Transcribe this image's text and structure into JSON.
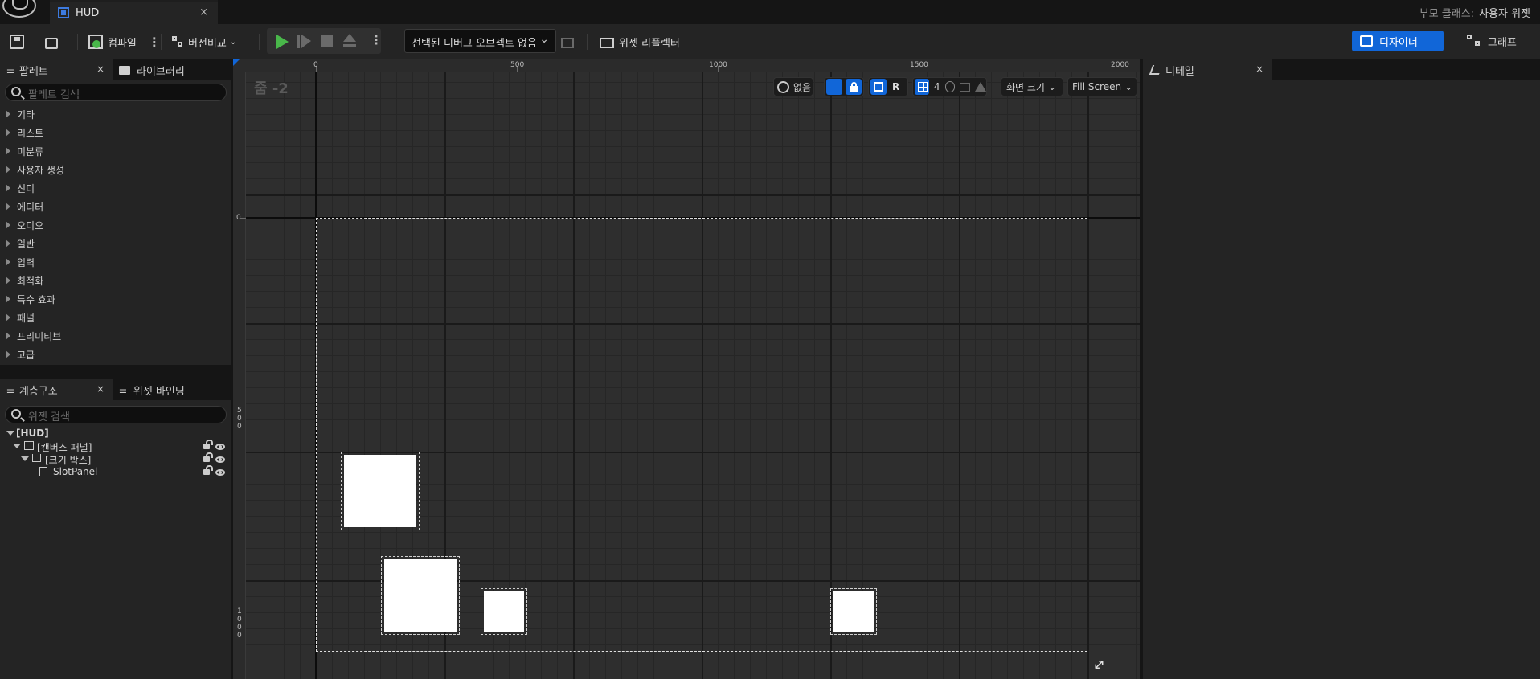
{
  "title_bar": {
    "tab_label": "HUD",
    "tab_close": "×",
    "parent_class_label": "부모 클래스:",
    "parent_class_value": "사용자 위젯"
  },
  "toolbar": {
    "compile_label": "컴파일",
    "diff_label": "버전비교",
    "debug_select_value": "선택된 디버그 오브젝트 없음",
    "widget_reflector_label": "위젯 리플렉터",
    "designer_label": "디자이너",
    "graph_label": "그래프"
  },
  "palette": {
    "tab_palette": "팔레트",
    "tab_library": "라이브러리",
    "close": "×",
    "search_placeholder": "팔레트 검색",
    "categories": [
      "기타",
      "리스트",
      "미분류",
      "사용자 생성",
      "신디",
      "에디터",
      "오디오",
      "일반",
      "입력",
      "최적화",
      "특수 효과",
      "패널",
      "프리미티브",
      "고급"
    ]
  },
  "hierarchy": {
    "tab_hierarchy": "계층구조",
    "tab_bindings": "위젯 바인딩",
    "close": "×",
    "search_placeholder": "위젯 검색",
    "root": "[HUD]",
    "items": [
      "[캔버스 패널]",
      "[크기 박스]",
      "SlotPanel"
    ]
  },
  "designer": {
    "zoom_label": "줌 -2",
    "ruler_top": [
      "0",
      "500",
      "1000",
      "1500",
      "2000"
    ],
    "ruler_left": [
      "0",
      "5\n0\n0",
      "1\n0\n0\n0"
    ],
    "localize_label": "없음",
    "respect_locks": "R",
    "grid_snap_value": "4",
    "screen_size_label": "화면 크기",
    "fill_mode_label": "Fill Screen"
  },
  "details": {
    "tab_label": "디테일",
    "close": "×"
  },
  "colors": {
    "accent_blue": "#1166d8",
    "play_green": "#49b74a",
    "panel_bg": "#242424",
    "canvas_bg": "#2e2e2e"
  }
}
